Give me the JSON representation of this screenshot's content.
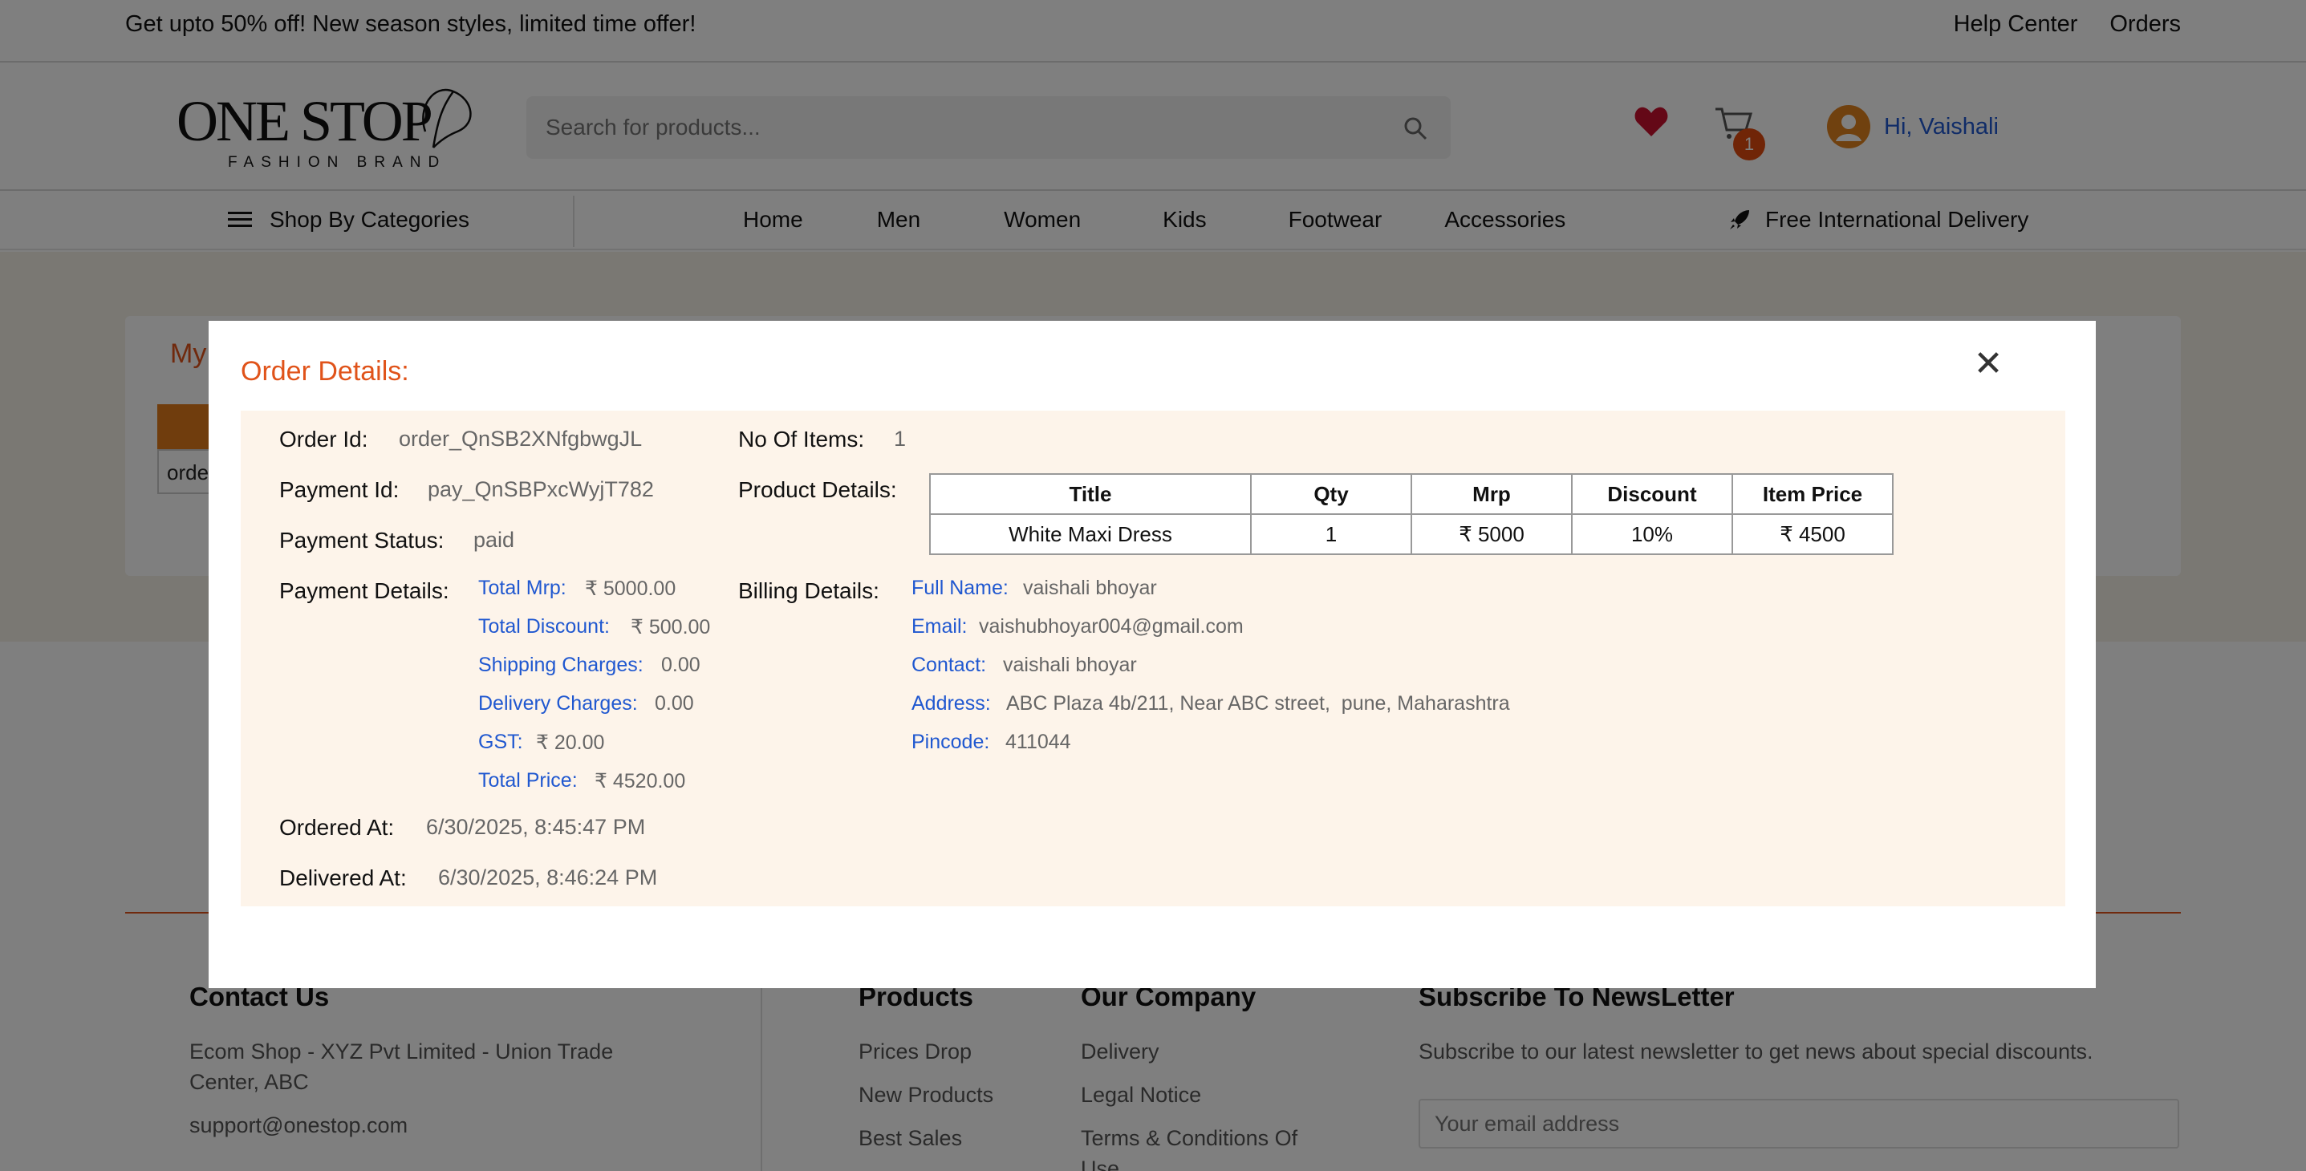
{
  "promo": {
    "message": "Get upto 50% off! New season styles, limited time offer!",
    "links": [
      "Help Center",
      "Orders"
    ]
  },
  "header": {
    "logo_word": "ONE STOP",
    "logo_sub": "FASHION BRAND",
    "search_placeholder": "Search for products...",
    "cart_count": "1",
    "user_greeting": "Hi, Vaishali",
    "accent_color": "#e0531a",
    "link_color": "#2058d0"
  },
  "nav": {
    "categories_label": "Shop By Categories",
    "items": [
      "Home",
      "Men",
      "Women",
      "Kids",
      "Footwear",
      "Accessories"
    ],
    "delivery_label": "Free International Delivery"
  },
  "background_page": {
    "card_title": "My",
    "cell_text": "orde"
  },
  "footer": {
    "contact": {
      "title": "Contact Us",
      "address": "Ecom Shop - XYZ Pvt Limited - Union Trade Center, ABC",
      "email": "support@onestop.com"
    },
    "products": {
      "title": "Products",
      "items": [
        "Prices Drop",
        "New Products",
        "Best Sales"
      ]
    },
    "company": {
      "title": "Our Company",
      "items": [
        "Delivery",
        "Legal Notice",
        "Terms & Conditions Of Use"
      ]
    },
    "newsletter": {
      "title": "Subscribe To NewsLetter",
      "text": "Subscribe to our latest newsletter to get news about special discounts.",
      "placeholder": "Your email address"
    }
  },
  "modal": {
    "title": "Order Details:",
    "close_symbol": "✕",
    "order_id_label": "Order Id:",
    "order_id": "order_QnSB2XNfgbwgJL",
    "payment_id_label": "Payment Id:",
    "payment_id": "pay_QnSBPxcWyjT782",
    "payment_status_label": "Payment Status:",
    "payment_status": "paid",
    "payment_details_label": "Payment Details:",
    "payment_details": [
      {
        "label": "Total Mrp:",
        "value": "₹ 5000.00"
      },
      {
        "label": "Total Discount:",
        "value": "₹ 500.00"
      },
      {
        "label": "Shipping Charges:",
        "value": "0.00"
      },
      {
        "label": "Delivery Charges:",
        "value": "0.00"
      },
      {
        "label": "GST:",
        "value": "₹ 20.00"
      },
      {
        "label": "Total Price:",
        "value": "₹ 4520.00"
      }
    ],
    "ordered_at_label": "Ordered At:",
    "ordered_at": "6/30/2025, 8:45:47 PM",
    "delivered_at_label": "Delivered At:",
    "delivered_at": "6/30/2025, 8:46:24 PM",
    "items_label": "No Of Items:",
    "items_count": "1",
    "product_details_label": "Product Details:",
    "product_table": {
      "headers": [
        "Title",
        "Qty",
        "Mrp",
        "Discount",
        "Item Price"
      ],
      "rows": [
        [
          "White Maxi Dress",
          "1",
          "₹ 5000",
          "10%",
          "₹ 4500"
        ]
      ]
    },
    "billing_details_label": "Billing Details:",
    "billing": [
      {
        "label": "Full Name:",
        "value": "vaishali bhoyar"
      },
      {
        "label": "Email:",
        "value": "vaishubhoyar004@gmail.com"
      },
      {
        "label": "Contact:",
        "value": "vaishali bhoyar"
      },
      {
        "label": "Address:",
        "value": "ABC Plaza 4b/211, Near ABC street,  pune, Maharashtra"
      },
      {
        "label": "Pincode:",
        "value": "411044"
      }
    ]
  }
}
